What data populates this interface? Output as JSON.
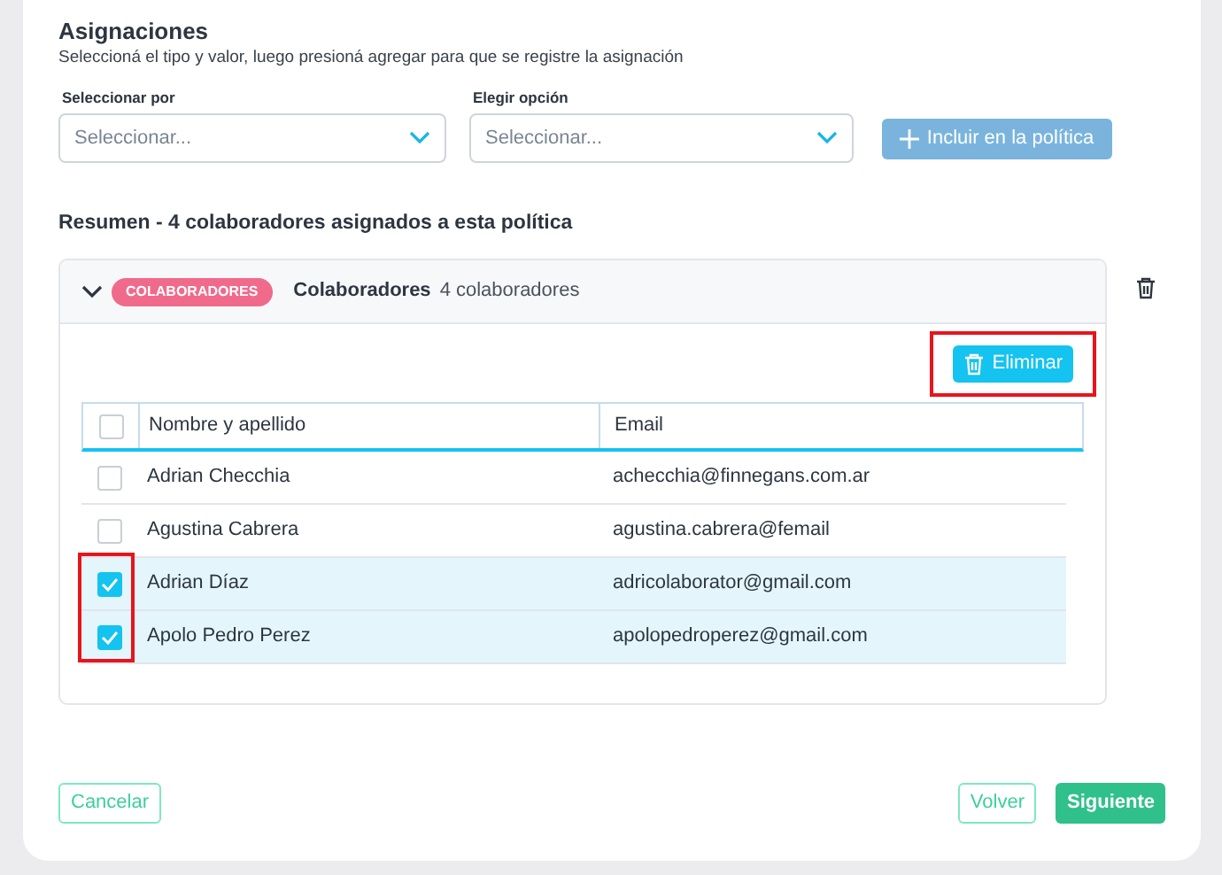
{
  "section": {
    "title": "Asignaciones",
    "subtitle": "Seleccioná el tipo y valor, luego presioná agregar para que se registre la asignación"
  },
  "filters": [
    {
      "label": "Seleccionar por",
      "placeholder": "Seleccionar..."
    },
    {
      "label": "Elegir opción",
      "placeholder": "Seleccionar..."
    }
  ],
  "add_button": {
    "label": "Incluir en la política",
    "disabled": true
  },
  "summary": "Resumen - 4 colaboradores asignados a esta política",
  "group": {
    "expanded": true,
    "tag": "COLABORADORES",
    "title": "Colaboradores",
    "count": "4 colaboradores"
  },
  "delete_button": {
    "label": "Eliminar",
    "highlighted": true
  },
  "table": {
    "columns": [
      "Nombre y apellido",
      "Email"
    ],
    "all_checked": false,
    "rows": [
      {
        "name": "Adrian Checchia",
        "email": "achecchia@finnegans.com.ar",
        "checked": false
      },
      {
        "name": "Agustina Cabrera",
        "email": "agustina.cabrera@femail",
        "checked": false
      },
      {
        "name": "Adrian Díaz",
        "email": "adricolaborator@gmail.com",
        "checked": true
      },
      {
        "name": "Apolo Pedro Perez",
        "email": "apolopedroperez@gmail.com",
        "checked": true
      }
    ]
  },
  "footer": {
    "cancel": "Cancelar",
    "back": "Volver",
    "next": "Siguiente"
  }
}
